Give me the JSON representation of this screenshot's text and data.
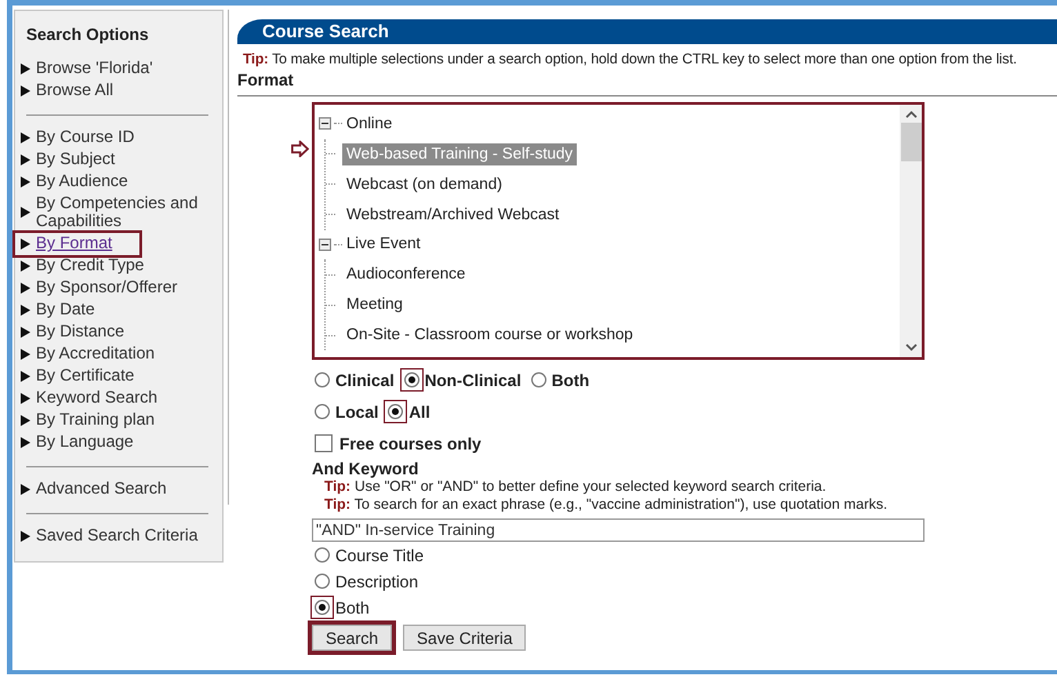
{
  "sidebar": {
    "title": "Search Options",
    "sections": [
      {
        "items": [
          {
            "label": "Browse 'Florida'",
            "highlighted": false
          },
          {
            "label": "Browse All",
            "highlighted": false
          }
        ]
      },
      {
        "items": [
          {
            "label": "By Course ID",
            "highlighted": false
          },
          {
            "label": "By Subject",
            "highlighted": false
          },
          {
            "label": "By Audience",
            "highlighted": false
          },
          {
            "label": "By Competencies and Capabilities",
            "highlighted": false
          },
          {
            "label": "By Format",
            "highlighted": true
          },
          {
            "label": "By Credit Type",
            "highlighted": false
          },
          {
            "label": "By Sponsor/Offerer",
            "highlighted": false
          },
          {
            "label": "By Date",
            "highlighted": false
          },
          {
            "label": "By Distance",
            "highlighted": false
          },
          {
            "label": "By Accreditation",
            "highlighted": false
          },
          {
            "label": "By Certificate",
            "highlighted": false
          },
          {
            "label": "Keyword Search",
            "highlighted": false
          },
          {
            "label": "By Training plan",
            "highlighted": false
          },
          {
            "label": "By Language",
            "highlighted": false
          }
        ]
      },
      {
        "items": [
          {
            "label": "Advanced Search",
            "highlighted": false
          }
        ]
      },
      {
        "items": [
          {
            "label": "Saved Search Criteria",
            "highlighted": false
          }
        ]
      }
    ]
  },
  "main": {
    "title": "Course Search",
    "tip": "**Tip:** To make multiple selections under a search option, hold down the CTRL key to select more than one option from the list.",
    "format_label": "Format",
    "format_list": {
      "highlighted": true,
      "tree": [
        {
          "label": "Online",
          "expanded": true,
          "children": [
            {
              "label": "Web-based Training - Self-study",
              "selected": true
            },
            {
              "label": "Webcast (on demand)",
              "selected": false
            },
            {
              "label": "Webstream/Archived Webcast",
              "selected": false
            }
          ]
        },
        {
          "label": "Live Event",
          "expanded": true,
          "children": [
            {
              "label": "Audioconference",
              "selected": false
            },
            {
              "label": "Meeting",
              "selected": false
            },
            {
              "label": "On-Site - Classroom course or workshop",
              "selected": false
            }
          ]
        }
      ]
    },
    "radio_groups": [
      {
        "bold": true,
        "options": [
          {
            "label": "Clinical",
            "selected": false,
            "highlighted": false
          },
          {
            "label": "Non-Clinical",
            "selected": true,
            "highlighted": true
          },
          {
            "label": "Both",
            "selected": false,
            "highlighted": false
          }
        ]
      },
      {
        "bold": true,
        "options": [
          {
            "label": "Local",
            "selected": false,
            "highlighted": false
          },
          {
            "label": "All",
            "selected": true,
            "highlighted": true
          }
        ]
      }
    ],
    "free_courses": {
      "label": "Free courses only",
      "checked": false
    },
    "keyword_label": "And Keyword",
    "keyword_tips": [
      "**Tip:** Use \"OR\" or \"AND\" to better define your selected keyword search criteria.",
      "**Tip:** To search for an exact phrase (e.g., \"vaccine administration\"), use quotation marks."
    ],
    "keyword_value": "\"AND\" In-service Training",
    "search_in": [
      {
        "label": "Course Title",
        "selected": false,
        "highlighted": false
      },
      {
        "label": "Description",
        "selected": false,
        "highlighted": false
      },
      {
        "label": "Both",
        "selected": true,
        "highlighted": true
      }
    ],
    "buttons": [
      {
        "label": "Search",
        "highlighted": true
      },
      {
        "label": "Save Criteria",
        "highlighted": false
      }
    ]
  }
}
